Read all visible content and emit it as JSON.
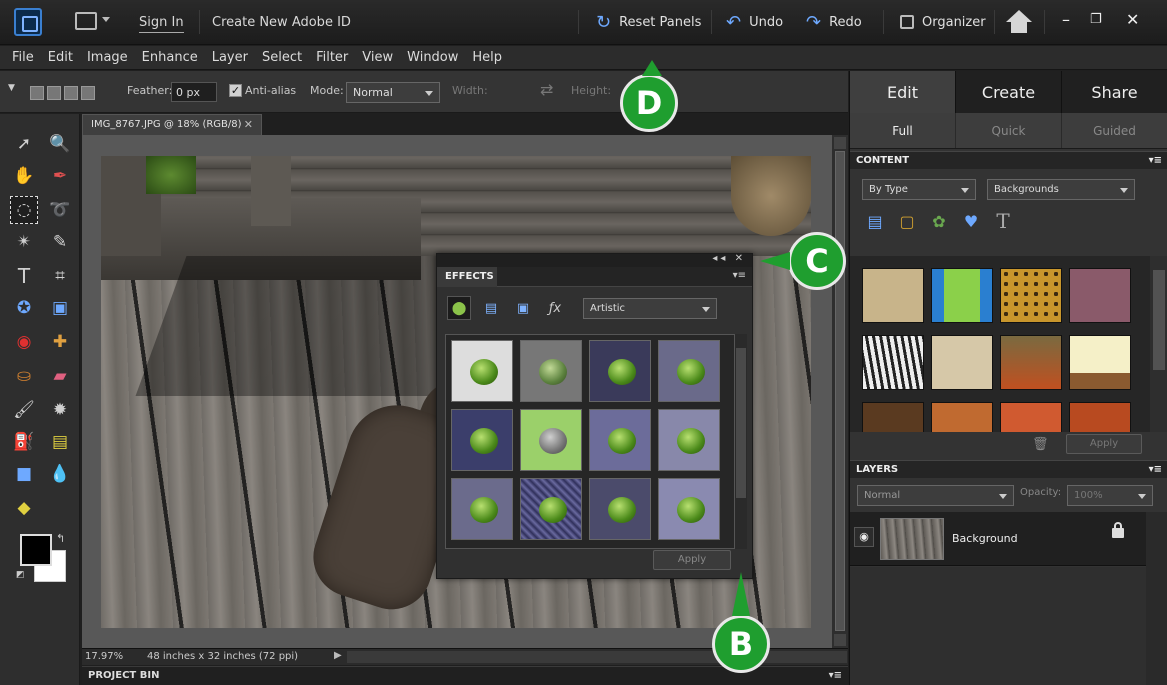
{
  "appbar": {
    "sign_in": "Sign In",
    "create_id": "Create New Adobe ID",
    "reset_panels": "Reset Panels",
    "undo": "Undo",
    "redo": "Redo",
    "organizer": "Organizer"
  },
  "menu": [
    "File",
    "Edit",
    "Image",
    "Enhance",
    "Layer",
    "Select",
    "Filter",
    "View",
    "Window",
    "Help"
  ],
  "options": {
    "feather_label": "Feather:",
    "feather_value": "0 px",
    "antialias_label": "Anti-alias",
    "mode_label": "Mode:",
    "mode_value": "Normal",
    "width_label": "Width:",
    "height_label": "Height:"
  },
  "document": {
    "tab_title": "IMG_8767.JPG @ 18% (RGB/8)",
    "zoom": "17.97%",
    "dimensions": "48 inches x 32 inches (72 ppi)"
  },
  "project_bin": "PROJECT BIN",
  "effects_panel": {
    "title": "EFFECTS",
    "filter_category": "Artistic",
    "apply": "Apply"
  },
  "callouts": {
    "b": "B",
    "c": "C",
    "d": "D"
  },
  "right_panel": {
    "modes": [
      "Edit",
      "Create",
      "Share"
    ],
    "active_mode": "Edit",
    "edit_modes": [
      "Full",
      "Quick",
      "Guided"
    ],
    "active_edit_mode": "Full",
    "content": {
      "title": "CONTENT",
      "sort_by": "By Type",
      "category": "Backgrounds",
      "apply": "Apply"
    },
    "layers": {
      "title": "LAYERS",
      "blend_mode": "Normal",
      "opacity_label": "Opacity:",
      "opacity_value": "100%",
      "layer_name": "Background"
    }
  },
  "colors": {
    "callout_green": "#1f9e2f",
    "accent_blue": "#6ea9ff",
    "foreground_swatch": "#000000",
    "background_swatch": "#ffffff"
  }
}
